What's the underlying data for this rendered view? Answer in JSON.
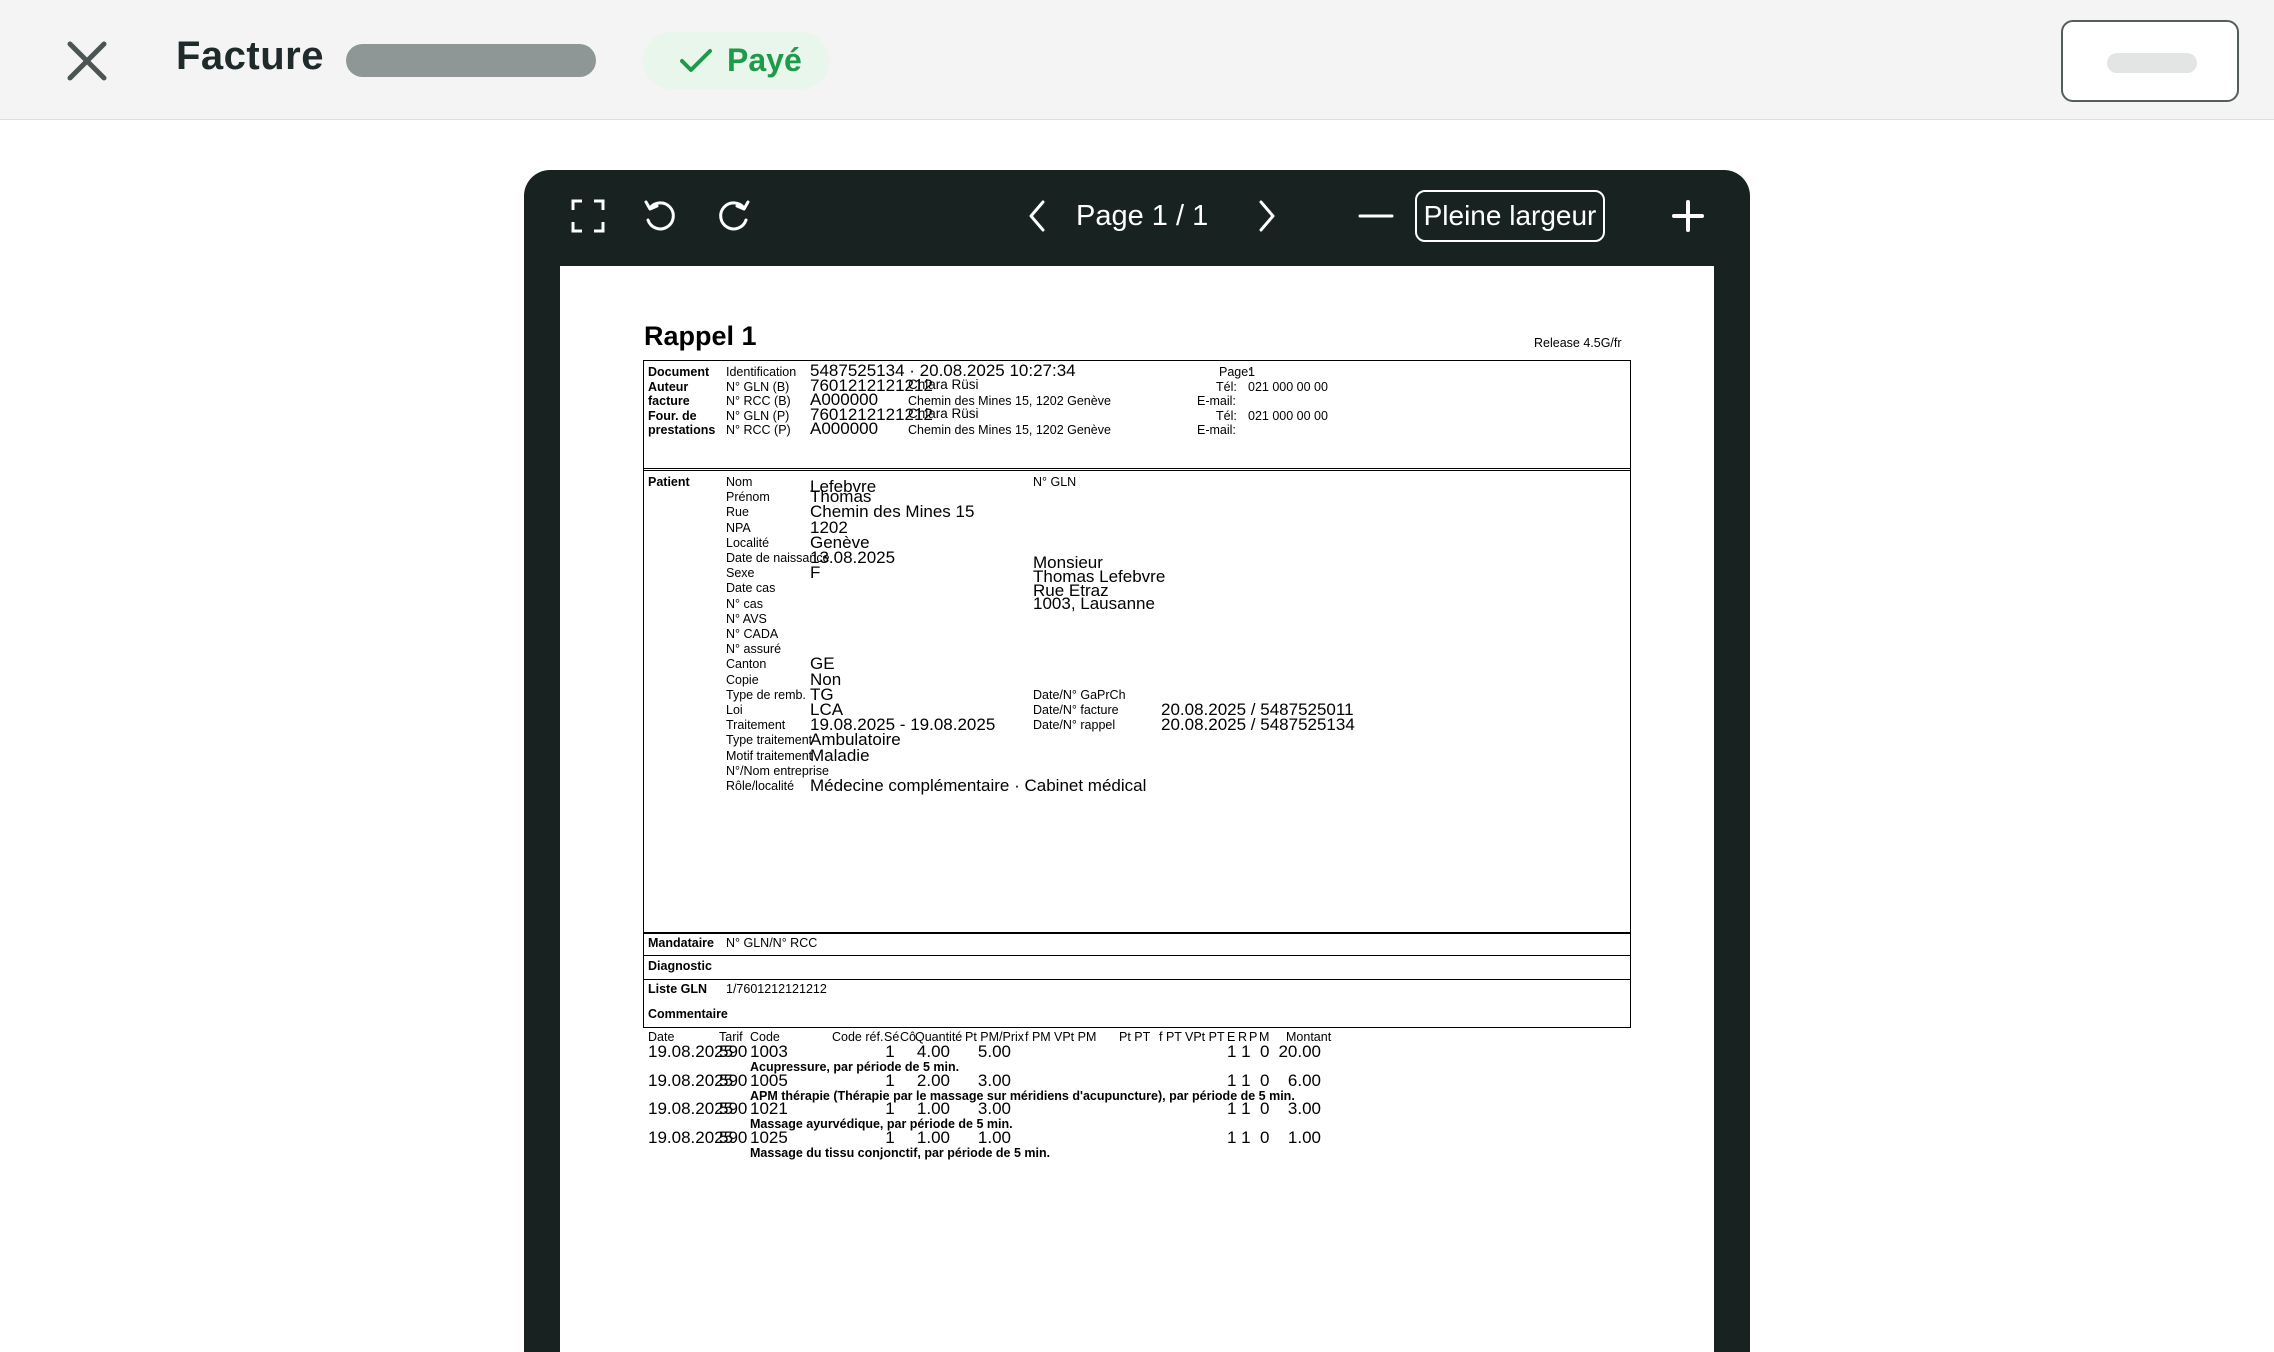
{
  "topbar": {
    "title": "Facture",
    "status": "Payé"
  },
  "viewer": {
    "page_indicator": "Page 1 / 1",
    "full_width_label": "Pleine largeur"
  },
  "invoice": {
    "heading": "Rappel 1",
    "release": "Release 4.5G/fr",
    "doc_labels": [
      "Document",
      "Auteur",
      "facture",
      "Four. de",
      "prestations"
    ],
    "doc_sublabels": [
      "Identification",
      "N° GLN (B)",
      "N° RCC (B)",
      "N° GLN (P)",
      "N° RCC (P)"
    ],
    "doc_values": [
      "5487525134 · 20.08.2025 10:27:34",
      "7601212121212",
      "A000000",
      "7601212121212",
      "A000000"
    ],
    "doc_names": [
      "Chiara Rüsi",
      "Chemin des Mines 15, 1202 Genève",
      "Chiara Rüsi",
      "Chemin des Mines 15, 1202 Genève"
    ],
    "doc_right_labels": [
      "Page:",
      "Tél:",
      "E-mail:",
      "Tél:",
      "E-mail:"
    ],
    "doc_right_values": [
      "1",
      "021 000 00 00",
      "021 000 00 00"
    ],
    "patient_label": "Patient",
    "patient_fields": [
      {
        "label": "Nom",
        "value": "Lefebvre"
      },
      {
        "label": "Prénom",
        "value": "Thomas"
      },
      {
        "label": "Rue",
        "value": "Chemin des Mines 15"
      },
      {
        "label": "NPA",
        "value": "1202"
      },
      {
        "label": "Localité",
        "value": "Genève"
      },
      {
        "label": "Date de naissance",
        "value": "13.08.2025"
      },
      {
        "label": "Sexe",
        "value": "F"
      },
      {
        "label": "Date cas",
        "value": ""
      },
      {
        "label": "N° cas",
        "value": ""
      },
      {
        "label": "N° AVS",
        "value": ""
      },
      {
        "label": "N° CADA",
        "value": ""
      },
      {
        "label": "N° assuré",
        "value": ""
      },
      {
        "label": "Canton",
        "value": "GE"
      },
      {
        "label": "Copie",
        "value": "Non"
      },
      {
        "label": "Type de remb.",
        "value": "TG"
      },
      {
        "label": "Loi",
        "value": "LCA"
      },
      {
        "label": "Traitement",
        "value": "19.08.2025 - 19.08.2025"
      },
      {
        "label": "Type traitement",
        "value": "Ambulatoire"
      },
      {
        "label": "Motif traitement",
        "value": "Maladie"
      },
      {
        "label": "N°/Nom entreprise",
        "value": ""
      },
      {
        "label": "Rôle/localité",
        "value": "Médecine complémentaire · Cabinet médical"
      }
    ],
    "gln_label": "N° GLN",
    "address": [
      "Monsieur",
      "Thomas Lefebvre",
      "Rue Etraz",
      "1003, Lausanne"
    ],
    "refs": [
      {
        "label": "Date/N° GaPrCh",
        "value": ""
      },
      {
        "label": "Date/N° facture",
        "value": "20.08.2025 / 5487525011"
      },
      {
        "label": "Date/N° rappel",
        "value": "20.08.2025 / 5487525134"
      }
    ],
    "mandataire_label": "Mandataire",
    "mandataire_value": "N° GLN/N° RCC",
    "diagnostic_label": "Diagnostic",
    "liste_gln_label": "Liste GLN",
    "liste_gln_value": "1/7601212121212",
    "commentaire_label": "Commentaire",
    "columns": [
      "Date",
      "Tarif",
      "Code",
      "Code réf.",
      "Sé",
      "Cô",
      "Quantité",
      "Pt PM/Prix",
      "f PM",
      "VPt PM",
      "Pt PT",
      "f PT",
      "VPt PT",
      "E",
      "R",
      "P",
      "M",
      "Montant"
    ],
    "rows": [
      {
        "date": "19.08.2025",
        "tarif": "590",
        "code": "1003",
        "se": "1",
        "qty": "4.00",
        "price": "5.00",
        "e": "1",
        "r": "1",
        "m": "0",
        "amount": "20.00",
        "desc": "Acupressure, par période de 5 min."
      },
      {
        "date": "19.08.2025",
        "tarif": "590",
        "code": "1005",
        "se": "1",
        "qty": "2.00",
        "price": "3.00",
        "e": "1",
        "r": "1",
        "m": "0",
        "amount": "6.00",
        "desc": "APM thérapie (Thérapie par le massage sur méridiens d'acupuncture), par période de 5 min."
      },
      {
        "date": "19.08.2025",
        "tarif": "590",
        "code": "1021",
        "se": "1",
        "qty": "1.00",
        "price": "3.00",
        "e": "1",
        "r": "1",
        "m": "0",
        "amount": "3.00",
        "desc": "Massage ayurvédique, par période de 5 min."
      },
      {
        "date": "19.08.2025",
        "tarif": "590",
        "code": "1025",
        "se": "1",
        "qty": "1.00",
        "price": "1.00",
        "e": "1",
        "r": "1",
        "m": "0",
        "amount": "1.00",
        "desc": "Massage du tissu conjonctif, par période de 5 min."
      }
    ]
  }
}
